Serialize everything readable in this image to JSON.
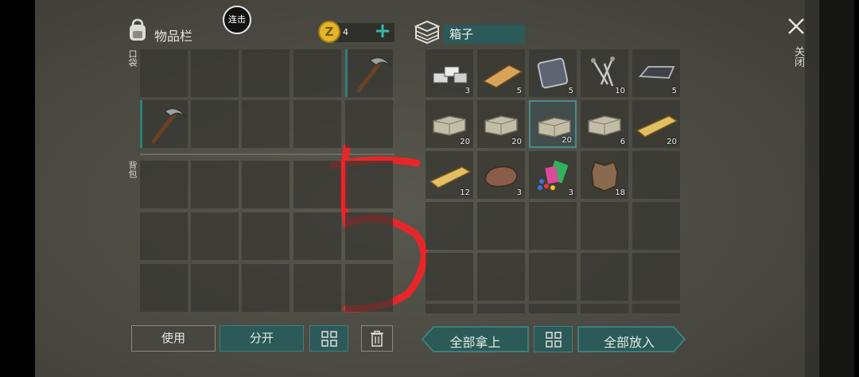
{
  "left_panel": {
    "title": "物品栏",
    "combo_label": "连击",
    "coin_count": "4",
    "pocket_label": "口袋",
    "backpack_label": "背包",
    "add_icon": "plus-icon",
    "backpack_icon": "backpack-icon"
  },
  "right_panel": {
    "title": "箱子",
    "box_icon": "crate-icon",
    "close_label": "关闭"
  },
  "buttons": {
    "use": "使用",
    "split": "分开",
    "take_all": "全部拿上",
    "put_all": "全部放入"
  },
  "pocket_items": [
    {
      "name": "pickaxe",
      "slot": 4
    },
    {
      "name": "pickaxe",
      "slot": 5
    }
  ],
  "chest_items": [
    {
      "name": "iron-bars",
      "count": "3"
    },
    {
      "name": "plank",
      "count": "5"
    },
    {
      "name": "metal-plate",
      "count": "5"
    },
    {
      "name": "nails",
      "count": "10"
    },
    {
      "name": "iron-ingot",
      "count": "5"
    },
    {
      "name": "stone-block",
      "count": "20"
    },
    {
      "name": "stone-block",
      "count": "20"
    },
    {
      "name": "stone-block",
      "count": "20"
    },
    {
      "name": "stone-block",
      "count": "6"
    },
    {
      "name": "wood-plank",
      "count": "20"
    },
    {
      "name": "wood-plank",
      "count": "12"
    },
    {
      "name": "ore-rock",
      "count": "3"
    },
    {
      "name": "crystals-and-leaves",
      "count": "3"
    },
    {
      "name": "animal-hide",
      "count": "18"
    }
  ],
  "annotation": {
    "text": "5",
    "color": "#e8262a"
  },
  "colors": {
    "accent": "#2f7f7c",
    "accent_dark": "#2c5a58",
    "coin": "#e2b52a"
  }
}
